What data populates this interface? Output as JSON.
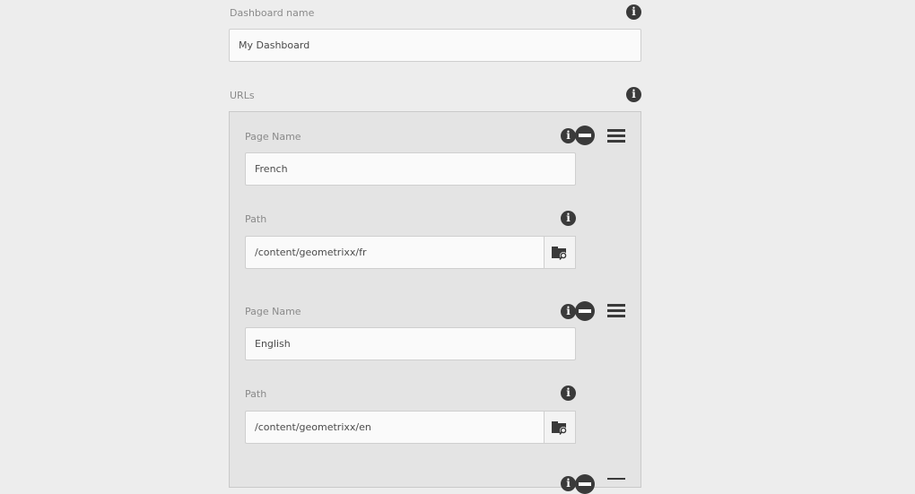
{
  "dashboard": {
    "name_label": "Dashboard name",
    "name_value": "My Dashboard"
  },
  "urls": {
    "label": "URLs",
    "items": [
      {
        "page_name_label": "Page Name",
        "page_name_value": "French",
        "path_label": "Path",
        "path_value": "/content/geometrixx/fr"
      },
      {
        "page_name_label": "Page Name",
        "page_name_value": "English",
        "path_label": "Path",
        "path_value": "/content/geometrixx/en"
      }
    ]
  },
  "icons": {
    "info": "info-icon",
    "remove": "remove-icon",
    "drag": "drag-handle-icon",
    "browse": "folder-search-icon"
  }
}
